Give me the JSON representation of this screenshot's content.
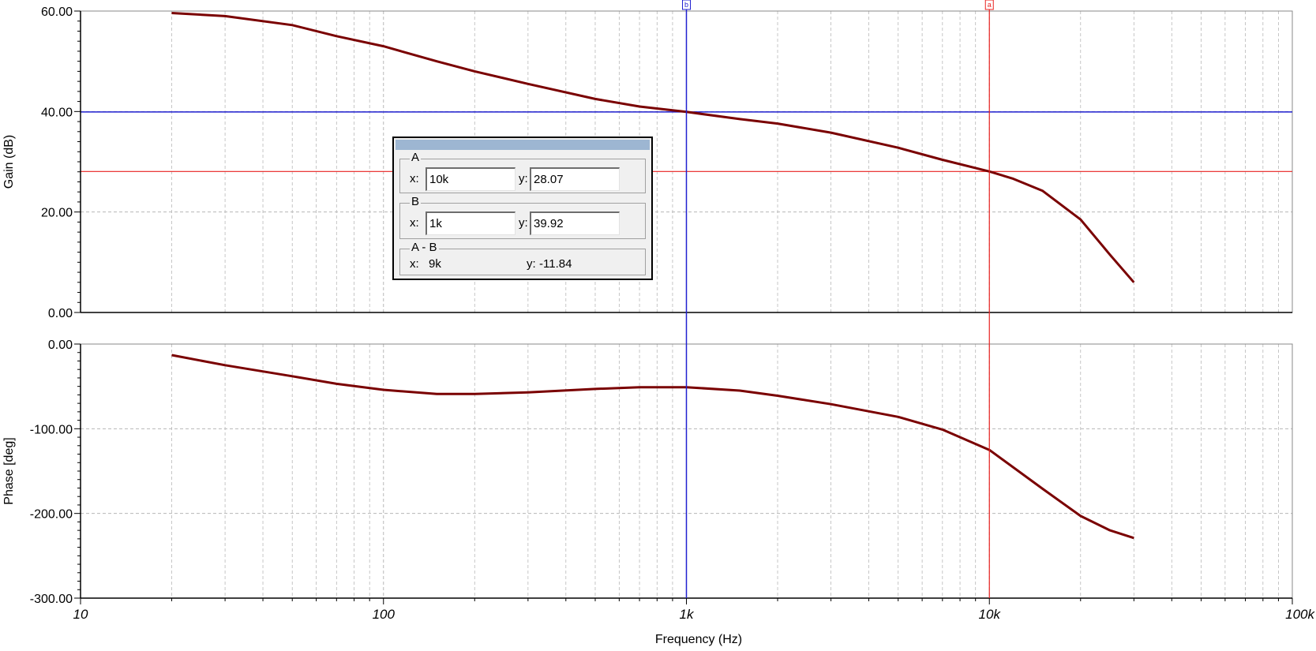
{
  "colors": {
    "trace": "#7a0000",
    "cursor_a": "#e8201f",
    "cursor_b": "#2020d0",
    "grid": "#b8b8b8"
  },
  "cursor_panel": {
    "a": {
      "title": "A",
      "x_label": "x:",
      "x_value": "10k",
      "y_label": "y:",
      "y_value": "28.07"
    },
    "b": {
      "title": "B",
      "x_label": "x:",
      "x_value": "1k",
      "y_label": "y:",
      "y_value": "39.92"
    },
    "diff": {
      "title": "A - B",
      "x_label": "x:",
      "x_value": "9k",
      "y_label": "y:",
      "y_value": "-11.84"
    }
  },
  "chart_data": [
    {
      "type": "line",
      "xlabel": "",
      "ylabel": "Gain (dB)",
      "x_scale": "log",
      "xlim": [
        10,
        100000
      ],
      "ylim": [
        0,
        60
      ],
      "y_ticks": [
        "60.00",
        "40.00",
        "20.00",
        "0.00"
      ],
      "y_tick_values": [
        60,
        40,
        20,
        0
      ],
      "grid": true,
      "cursors": [
        {
          "name": "a",
          "marker": "a",
          "x": 10000,
          "y": 28.07
        },
        {
          "name": "b",
          "marker": "b",
          "x": 1000,
          "y": 39.92
        }
      ],
      "series": [
        {
          "x": [
            20,
            30,
            50,
            70,
            100,
            150,
            200,
            300,
            500,
            700,
            1000,
            1500,
            2000,
            3000,
            5000,
            7000,
            10000,
            12000,
            15000,
            20000,
            25000,
            30000
          ],
          "y": [
            59.6,
            59.0,
            57.2,
            55.0,
            53.0,
            50.0,
            48.0,
            45.5,
            42.5,
            41.0,
            39.92,
            38.5,
            37.6,
            35.8,
            32.8,
            30.4,
            28.07,
            26.6,
            24.2,
            18.5,
            11.5,
            6.0
          ]
        }
      ]
    },
    {
      "type": "line",
      "xlabel": "Frequency (Hz)",
      "ylabel": "Phase [deg]",
      "x_scale": "log",
      "xlim": [
        10,
        100000
      ],
      "ylim": [
        -300,
        0
      ],
      "x_ticks": [
        "10",
        "100",
        "1k",
        "10k",
        "100k"
      ],
      "x_tick_values": [
        10,
        100,
        1000,
        10000,
        100000
      ],
      "y_ticks": [
        "0.00",
        "-100.00",
        "-200.00",
        "-300.00"
      ],
      "y_tick_values": [
        0,
        -100,
        -200,
        -300
      ],
      "grid": true,
      "series": [
        {
          "x": [
            20,
            30,
            50,
            70,
            100,
            150,
            200,
            300,
            500,
            700,
            1000,
            1500,
            2000,
            3000,
            5000,
            7000,
            10000,
            15000,
            20000,
            25000,
            30000
          ],
          "y": [
            -13,
            -25,
            -38,
            -47,
            -54,
            -59,
            -59,
            -57,
            -53,
            -51,
            -51,
            -55,
            -61,
            -71,
            -86,
            -101,
            -125,
            -171,
            -203,
            -220,
            -229
          ]
        }
      ]
    }
  ]
}
